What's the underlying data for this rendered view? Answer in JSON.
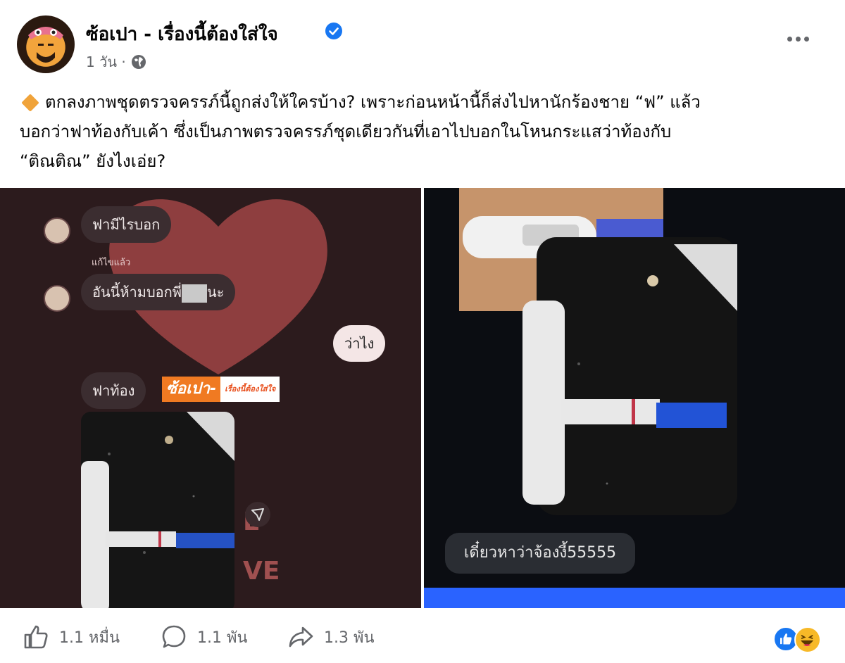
{
  "post": {
    "page_name": "ซ้อเปา - เรื่องนี้ต้องใส่ใจ",
    "time": "1 วัน ·",
    "caption_lines": [
      "ตกลงภาพชุดตรวจครรภ์นี้ถูกส่งให้ใครบ้าง? เพราะก่อนหน้านี้ก็ส่งไปหานักร้องชาย “ฟ” แล้ว",
      "บอกว่าฟาท้องกับเค้า ซึ่งเป็นภาพตรวจครรภ์ชุดเดียวกันที่เอาไปบอกในโหนกระแสว่าท้องกับ",
      "“ติณติณ” ยังไงเอ่ย?"
    ]
  },
  "left_image": {
    "bubble1": "ฟามีไรบอก",
    "edited_label": "แก้ไขแล้ว",
    "bubble2_pre": "อันนี้ห้ามบอกพี่",
    "bubble2_post": "นะ",
    "reply": "ว่าไง",
    "bubble3": "ฟาท้อง",
    "logo_main": "ซ้อเปา-",
    "logo_sub": "เรื่องนี้ต้องใส่ใจ",
    "love_text": "L\nVE"
  },
  "right_image": {
    "caption": "เดี๋ยวหาว่าจ้องงี้55555"
  },
  "footer": {
    "likes": "1.1 หมื่น",
    "comments": "1.1 พัน",
    "shares": "1.3 พัน"
  },
  "colors": {
    "accent": "#1877f2",
    "muted": "#65676b"
  }
}
